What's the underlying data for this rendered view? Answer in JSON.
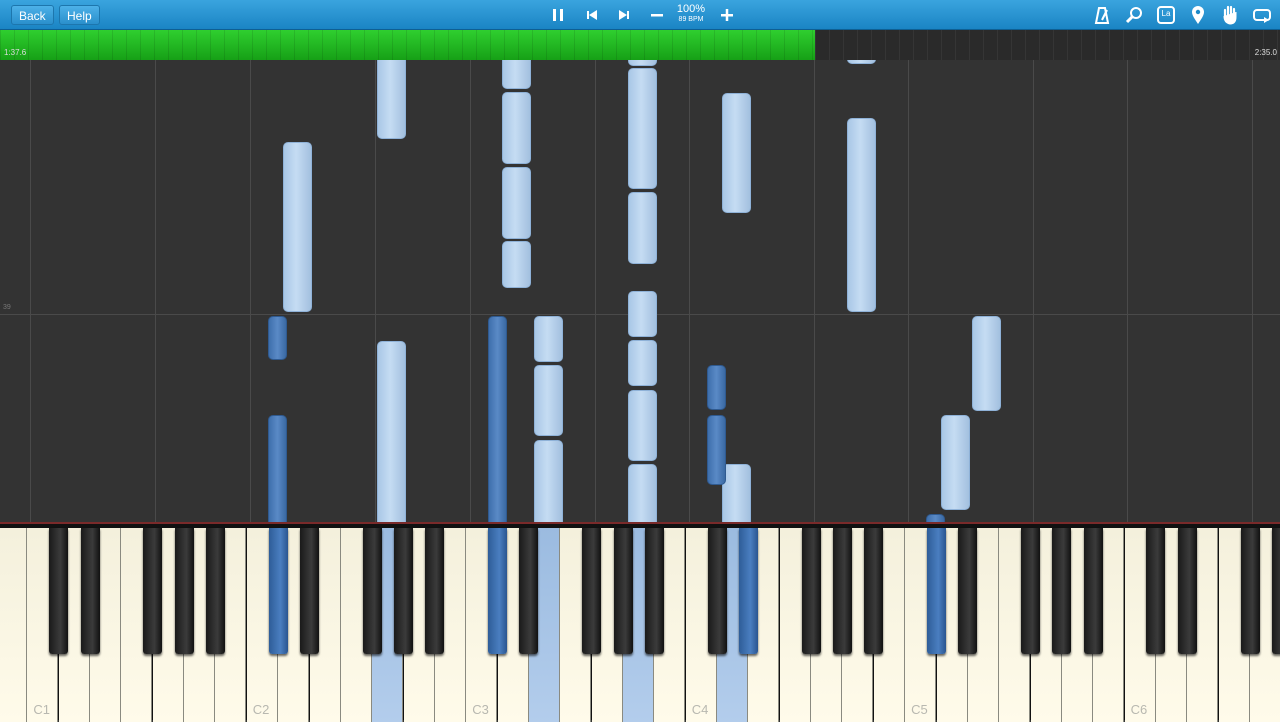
{
  "toolbar": {
    "back_label": "Back",
    "help_label": "Help",
    "speed_percent": "100%",
    "tempo": "89 BPM",
    "icons": [
      "pause-icon",
      "skip-back-icon",
      "skip-forward-icon",
      "minus-icon",
      "plus-icon",
      "metronome-icon",
      "search-icon",
      "note-label-icon",
      "marker-icon",
      "hand-icon",
      "loop-icon"
    ],
    "note_label_text": "La"
  },
  "progress": {
    "elapsed": "1:37.6",
    "total": "2:35.0",
    "fraction": 0.637,
    "color": "#1faa1f"
  },
  "field": {
    "measure_number": "39"
  },
  "keyboard": {
    "labels": [
      "C1",
      "C2",
      "C3",
      "C4",
      "C5",
      "C6"
    ]
  },
  "colors": {
    "note_light": "#b8d2ee",
    "note_dark": "#4a7cbc",
    "background": "#333333"
  }
}
